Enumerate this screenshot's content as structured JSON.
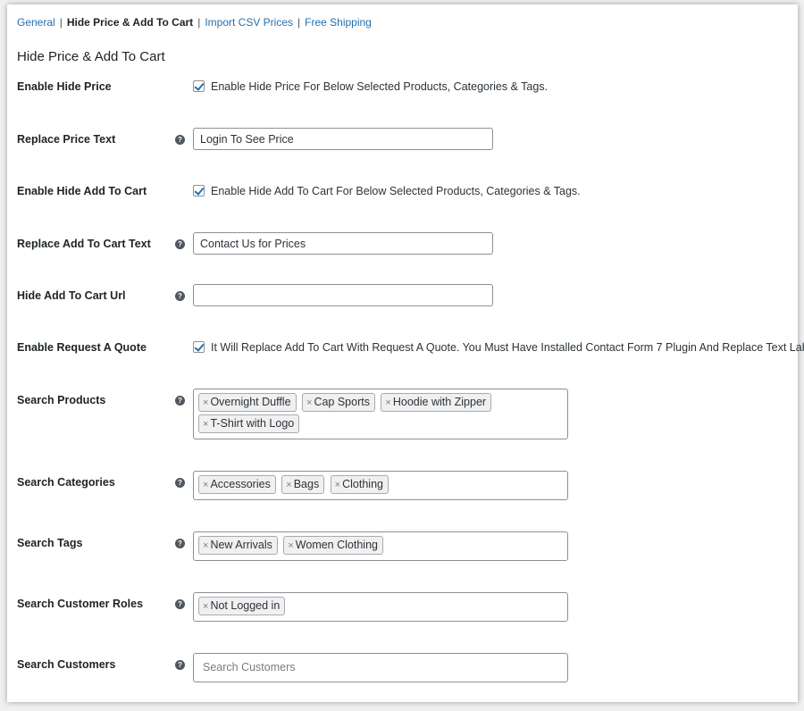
{
  "subnav": {
    "general": "General",
    "hide_price": "Hide Price & Add To Cart",
    "import_csv": "Import CSV Prices",
    "free_shipping": "Free Shipping",
    "separator": "|"
  },
  "page_title": "Hide Price & Add To Cart",
  "help_glyph": "?",
  "fields": {
    "enable_hide_price": {
      "label": "Enable Hide Price",
      "checked": true,
      "description": "Enable Hide Price For Below Selected Products, Categories & Tags."
    },
    "replace_price_text": {
      "label": "Replace Price Text",
      "value": "Login To See Price"
    },
    "enable_hide_add_to_cart": {
      "label": "Enable Hide Add To Cart",
      "checked": true,
      "description": "Enable Hide Add To Cart For Below Selected Products, Categories & Tags."
    },
    "replace_add_to_cart_text": {
      "label": "Replace Add To Cart Text",
      "value": "Contact Us for Prices"
    },
    "hide_add_to_cart_url": {
      "label": "Hide Add To Cart Url",
      "value": ""
    },
    "enable_request_quote": {
      "label": "Enable Request A Quote",
      "checked": true,
      "description": "It Will Replace Add To Cart With Request A Quote. You Must Have Installed Contact Form 7 Plugin And Replace Text Label."
    },
    "search_products": {
      "label": "Search Products",
      "tags": [
        "Overnight Duffle",
        "Cap Sports",
        "Hoodie with Zipper",
        "T-Shirt with Logo"
      ]
    },
    "search_categories": {
      "label": "Search Categories",
      "tags": [
        "Accessories",
        "Bags",
        "Clothing"
      ]
    },
    "search_tags": {
      "label": "Search Tags",
      "tags": [
        "New Arrivals",
        "Women Clothing"
      ]
    },
    "search_customer_roles": {
      "label": "Search Customer Roles",
      "tags": [
        "Not Logged in"
      ]
    },
    "search_customers": {
      "label": "Search Customers",
      "placeholder": "Search Customers"
    }
  },
  "tag_remove_glyph": "×",
  "colors": {
    "link": "#2271b1",
    "checkbox_check": "#2271b1",
    "tag_bg": "#f0f0f1"
  }
}
